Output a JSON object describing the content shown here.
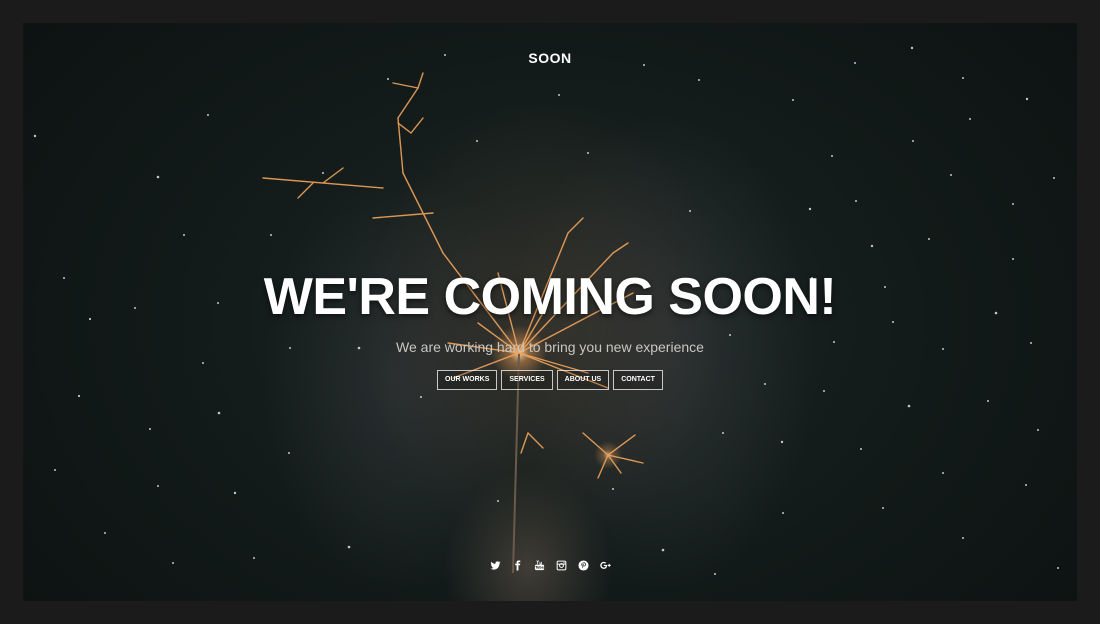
{
  "brand": {
    "name": "SOON"
  },
  "hero": {
    "headline": "WE'RE COMING SOON!",
    "subtitle": "We are working hard to bring you new experience"
  },
  "nav": {
    "items": [
      {
        "label": "OUR WORKS"
      },
      {
        "label": "SERVICES"
      },
      {
        "label": "ABOUT US"
      },
      {
        "label": "CONTACT"
      }
    ]
  },
  "social": {
    "icons": [
      "twitter-icon",
      "facebook-icon",
      "youtube-icon",
      "instagram-icon",
      "pinterest-icon",
      "google-plus-icon"
    ]
  },
  "colors": {
    "frame_background": "#1b1b1b",
    "hero_background": "#121a19",
    "text": "#ffffff",
    "spark": "#f2a45a"
  }
}
